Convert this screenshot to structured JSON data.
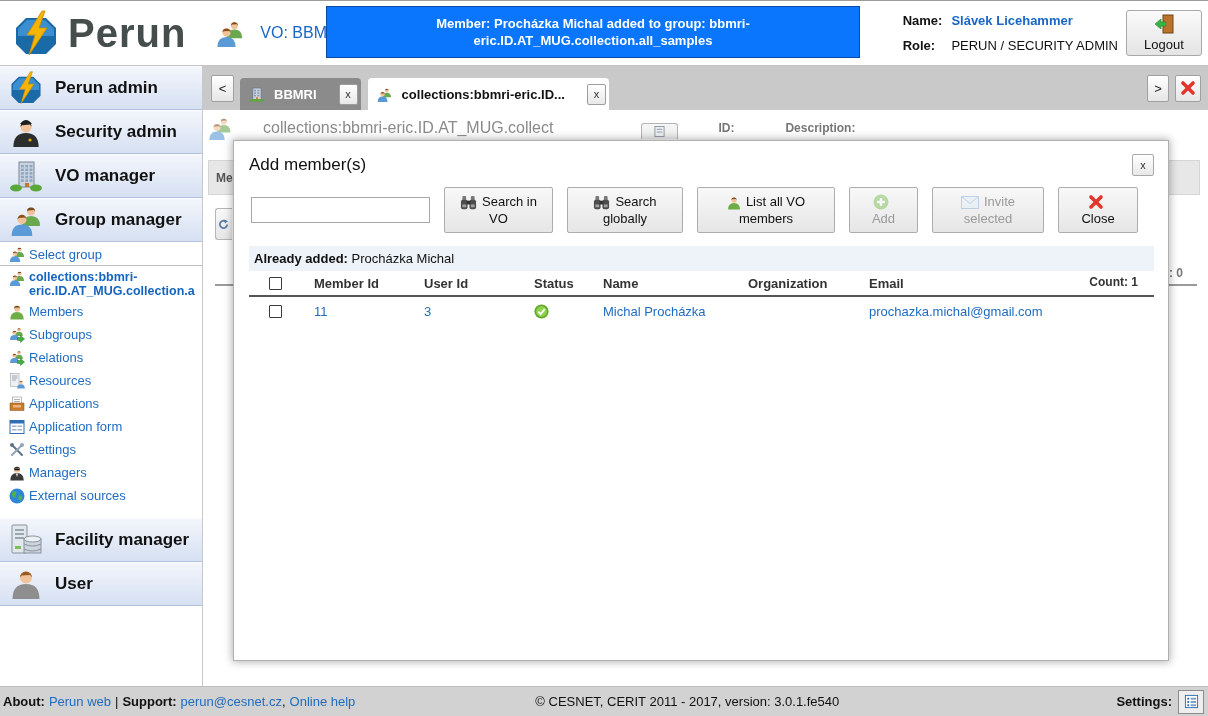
{
  "header": {
    "logo": "Perun",
    "context": "VO: BBM",
    "notification": "Member: Procházka Michal added to group: bbmri-eric.ID.AT_MUG.collection.all_samples",
    "user": [
      {
        "kind": "link",
        "label": "Name:",
        "value": "Slávek Licehammer"
      },
      {
        "kind": "text",
        "label": "Role:",
        "value": "PERUN / SECURITY ADMIN"
      }
    ],
    "logout": "Logout"
  },
  "sidebar": {
    "sections": [
      {
        "kind": "perun",
        "label": "Perun admin"
      },
      {
        "kind": "security",
        "label": "Security admin"
      },
      {
        "kind": "vo",
        "label": "VO manager"
      },
      {
        "kind": "group",
        "label": "Group manager",
        "menu": {
          "select": "Select group",
          "current": "collections:bbmri-eric.ID.AT_MUG.collection.a",
          "items": [
            {
              "kind": "members",
              "label": "Members"
            },
            {
              "kind": "subgroups",
              "label": "Subgroups"
            },
            {
              "kind": "relations",
              "label": "Relations"
            },
            {
              "kind": "resources",
              "label": "Resources"
            },
            {
              "kind": "applications",
              "label": "Applications"
            },
            {
              "kind": "form",
              "label": "Application form"
            },
            {
              "kind": "settings",
              "label": "Settings"
            },
            {
              "kind": "managers",
              "label": "Managers"
            },
            {
              "kind": "external",
              "label": "External sources"
            }
          ]
        }
      },
      {
        "kind": "facility",
        "label": "Facility manager"
      },
      {
        "kind": "user",
        "label": "User"
      }
    ]
  },
  "main": {
    "nav_prev": "<",
    "nav_next": ">",
    "tabs": [
      {
        "kind": "vo",
        "label": "BBMRI",
        "close": "x",
        "selected": false
      },
      {
        "kind": "group",
        "label": "collections:bbmri-eric.ID...",
        "close": "x",
        "selected": true
      }
    ],
    "page": {
      "title": "collections:bbmri-eric.ID.AT_MUG.collect",
      "id_label": "ID:",
      "description_label": "Description:",
      "subtab": "Me",
      "count": ": 0"
    }
  },
  "dialog": {
    "title": "Add member(s)",
    "close": "x",
    "buttons": [
      {
        "kind": "search",
        "label": "Search in VO",
        "disabled": false
      },
      {
        "kind": "search",
        "label": "Search globally",
        "disabled": false
      },
      {
        "kind": "member",
        "label": "List all VO members",
        "disabled": false
      },
      {
        "kind": "add",
        "label": "Add",
        "disabled": true
      },
      {
        "kind": "invite",
        "label": "Invite selected",
        "disabled": true
      },
      {
        "kind": "close",
        "label": "Close",
        "disabled": false
      }
    ],
    "already_added": "**Already added:** Procházka Michal",
    "table": {
      "select_all": {
        "checked": false
      },
      "columns": [
        "Member Id",
        "User Id",
        "Status",
        "Name",
        "Organization",
        "Email"
      ],
      "count": "Count: 1",
      "rows": [
        {
          "checked": false,
          "member_id": "11",
          "user_id": "3",
          "valid": true,
          "name": "Michal Procházka",
          "email": "prochazka.michal@gmail.com"
        }
      ]
    }
  },
  "footer": {
    "left": [
      {
        "kind": "label",
        "text": "About:"
      },
      {
        "kind": "link",
        "text": "Perun web"
      },
      {
        "kind": "separator",
        "text": "|"
      },
      {
        "kind": "label",
        "text": "Support:"
      },
      {
        "kind": "link",
        "text": "perun@cesnet.cz"
      },
      {
        "kind": "punct",
        "text": ","
      },
      {
        "kind": "link",
        "text": "Online help"
      }
    ],
    "copyright": "© CESNET, CERIT 2011 - 2017, version: 3.0.1.fe540",
    "settings_label": "Settings:"
  }
}
